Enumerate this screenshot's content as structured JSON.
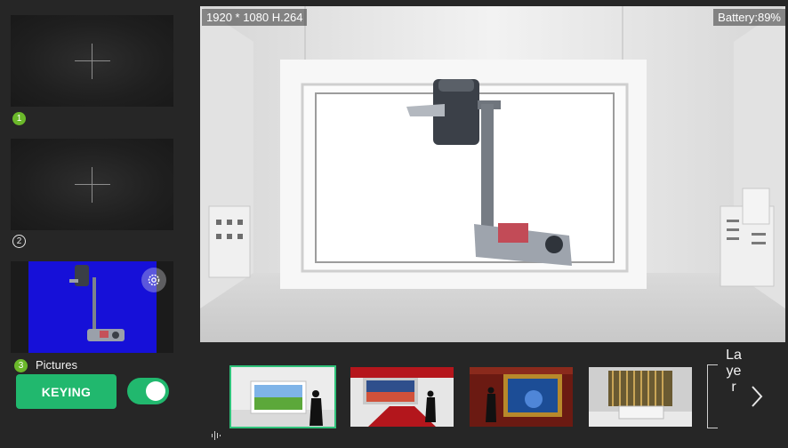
{
  "sources": [
    {
      "badge": "1",
      "state": "empty"
    },
    {
      "badge": "2",
      "state": "empty"
    },
    {
      "badge": "3",
      "label": "Pictures",
      "state": "image"
    }
  ],
  "controls": {
    "keying_label": "KEYING",
    "keying_toggle_on": true
  },
  "preview": {
    "resolution": "1920 * 1080  H.264",
    "battery": "Battery:89%"
  },
  "scenes": {
    "layer_label": "Layer",
    "items": [
      {
        "name": "scene-1",
        "selected": true
      },
      {
        "name": "scene-2",
        "selected": false
      },
      {
        "name": "scene-3",
        "selected": false
      },
      {
        "name": "scene-4",
        "selected": false
      }
    ]
  },
  "colors": {
    "accent_green": "#21b86e",
    "badge_green": "#6bb82a",
    "background": "#262626",
    "key_blue": "#1610d8"
  },
  "icons": [
    "plus-icon",
    "settings-icon",
    "audio-icon",
    "chevron-right-icon"
  ]
}
